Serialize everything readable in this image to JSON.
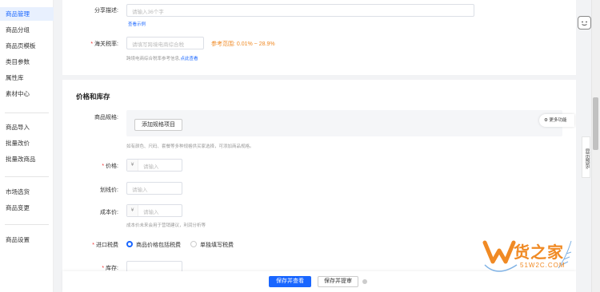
{
  "sidebar": {
    "items": [
      {
        "label": "商品管理",
        "active": true
      },
      {
        "label": "商品分组"
      },
      {
        "label": "商品页模板"
      },
      {
        "label": "类目参数"
      },
      {
        "label": "属性库"
      },
      {
        "label": "素材中心"
      },
      {
        "label": "商品导入"
      },
      {
        "label": "批量改价"
      },
      {
        "label": "批量改商品"
      },
      {
        "label": "市场选货"
      },
      {
        "label": "商品变更"
      },
      {
        "label": "商品设置"
      }
    ]
  },
  "share": {
    "label": "分享描述:",
    "placeholder": "请输入36个字",
    "example_link": "查看示例"
  },
  "customs": {
    "label": "海关税率:",
    "placeholder": "请填写跨境电商综合税",
    "range": "参考范围: 0.01% ~ 28.9%",
    "hint": "跨境电商综合税率参考信息,",
    "hint_link": "点此查看"
  },
  "price_section": {
    "title": "价格和库存",
    "spec_label": "商品规格:",
    "add_spec": "添加规格项目",
    "more_functions": "更多功能",
    "spec_hint": "如有颜色、尺码、套餐等多种规格供买家选择，可添加商品规格。",
    "price_label": "价格:",
    "price_prefix": "¥",
    "price_placeholder": "请输入",
    "strike_label": "划线价:",
    "strike_placeholder": "请输入",
    "cost_label": "成本价:",
    "cost_prefix": "¥",
    "cost_placeholder": "请输入",
    "cost_hint": "成本价未来会用于营销建议，利润分析等",
    "import_tax_label": "进口税费",
    "tax_option1": "商品价格包括税费",
    "tax_option2": "单独填写税费",
    "stock_label": "库存:"
  },
  "footer": {
    "save_view": "保存并查看",
    "save_submit": "保存并提审"
  },
  "rail": {
    "preview": "显示预览"
  },
  "watermark": {
    "brand": "货之家",
    "domain": "51W2C.COM"
  }
}
